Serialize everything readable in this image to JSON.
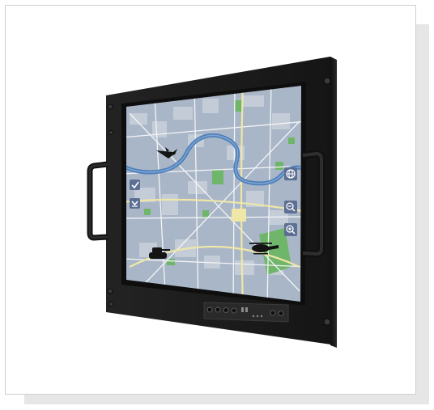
{
  "product": {
    "type": "rugged rack-mount military display",
    "screen_content": "city map",
    "colors": {
      "bezel": "#1c1c1c",
      "map_base": "#a9b6c7",
      "map_blocks": "#c4ccd7",
      "river": "#4f7fb8",
      "park": "#6fb56a",
      "road": "#f3f4f6",
      "highlight_road": "#efe7a8",
      "marker": "#141414",
      "map_button": "#5d6f92"
    }
  },
  "map_controls": {
    "left": [
      {
        "icon": "checkmark-icon"
      },
      {
        "icon": "chevron-down-icon"
      }
    ],
    "right": [
      {
        "icon": "globe-icon"
      },
      {
        "icon": "zoom-out-icon"
      },
      {
        "icon": "zoom-in-icon"
      }
    ]
  },
  "map_markers": [
    {
      "icon": "fighter-jet-icon"
    },
    {
      "icon": "tank-icon"
    },
    {
      "icon": "helicopter-icon"
    }
  ],
  "hardware_buttons": [
    {
      "icon": "power-icon"
    },
    {
      "icon": "menu-icon"
    },
    {
      "icon": "up-icon"
    },
    {
      "icon": "down-icon"
    },
    {
      "icon": "brightness-icon"
    },
    {
      "icon": "auto-icon"
    }
  ]
}
